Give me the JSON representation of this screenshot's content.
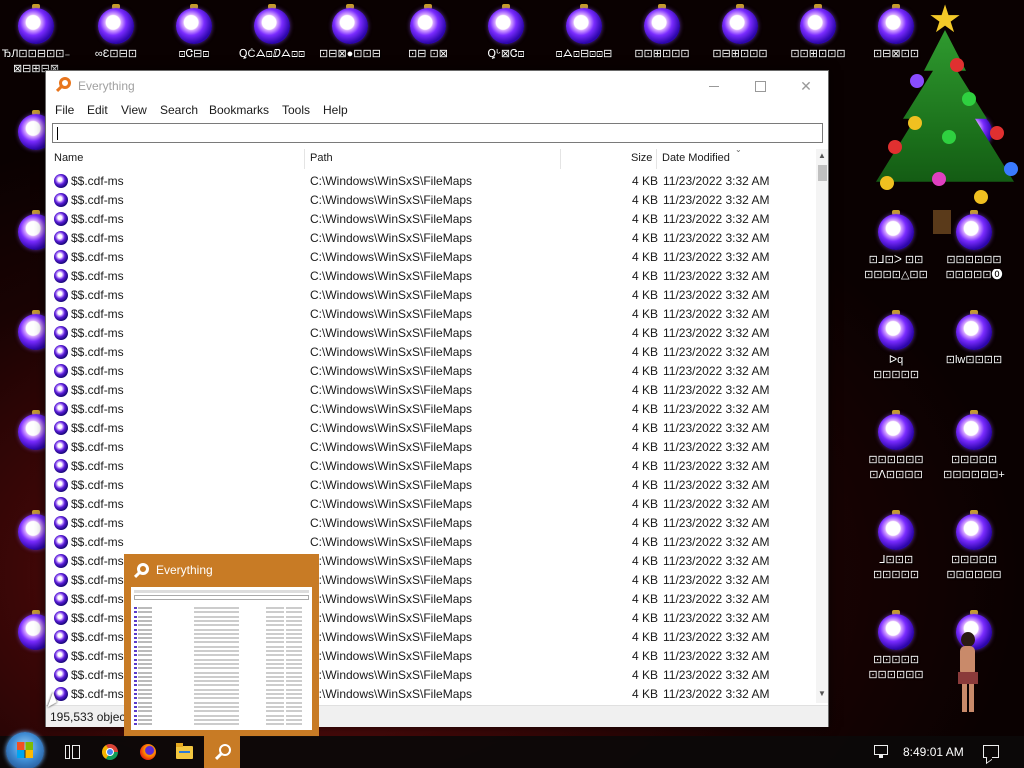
{
  "desktop": {
    "icons": [
      {
        "label": "ЂЛ⊡⊡⊟⊡⊡₋",
        "label2": "⊠⊟⊞⊟⊠"
      },
      {
        "label": "∞Ɛ⊡⊟⊡"
      },
      {
        "label": "⊡Ꮳ⊟⊡"
      },
      {
        "label": "ꝖČᗋ⊡ⅅᗋ⊡⊡"
      },
      {
        "label": "⊡⊟⊠●⊡⊡⊟"
      },
      {
        "label": "⊡⊟ ⊡⊠"
      },
      {
        "label": "Ꝗᒡ⊠Ꮳ⊡"
      },
      {
        "label": "⊡ᗋ⊡⊟⊡⊡⊟"
      },
      {
        "label": "⊡⊡⊞⊡⊡⊡"
      },
      {
        "label": "⊡⊟⊞⊡⊡⊡"
      },
      {
        "label": "⊡⊡⊞⊡⊡⊡"
      },
      {
        "label": "⊡⊟⊠⊡⊡"
      },
      {
        "label": "⊡⊡⊞⊡⊡⊡"
      }
    ],
    "right_labels": [
      {
        "a": "⊡ᐸ ⊡",
        "b": ""
      },
      {
        "a": "⊡ᒧ⊡ᐳ ⊡⊡",
        "b": "⊡⊡⊡⊡△⊡⊡"
      },
      {
        "a": "⊡⊡⊡⊡⊡⊡",
        "b": "⊡⊡⊡⊡⊡⓿"
      },
      {
        "a": "ᐅq",
        "b": "⊡⊡⊡⊡⊡"
      },
      {
        "a": "⊡lw⊡⊡⊡⊡",
        "b": ""
      },
      {
        "a": "⊡⊡⊡⊡⊡⊡",
        "b": "⊡ᐱ⊡⊡⊡⊡"
      },
      {
        "a": "⊡⊡⊡⊡⊡",
        "b": "⊡⊡⊡⊡⊡⊡+"
      },
      {
        "a": "ᒧ⊡⊡⊡",
        "b": "⊡⊡⊡⊡⊡"
      },
      {
        "a": "⊡⊡⊡⊡⊡",
        "b": "⊡⊡⊡⊡⊡⊡"
      },
      {
        "a": "⊡⊡⊡⊡⊡",
        "b": "⊡⊡⊡⊡⊡⊡"
      }
    ]
  },
  "window": {
    "title": "Everything",
    "controls": {
      "minimize": "",
      "maximize": "",
      "close": "✕"
    },
    "menu": [
      "File",
      "Edit",
      "View",
      "Search",
      "Bookmarks",
      "Tools",
      "Help"
    ],
    "search": {
      "value": "",
      "placeholder": ""
    },
    "columns": {
      "name": "Name",
      "path": "Path",
      "size": "Size",
      "date": "Date Modified"
    },
    "rows": [
      {
        "name": "$$.cdf-ms",
        "path": "C:\\Windows\\WinSxS\\FileMaps",
        "size": "4 KB",
        "date": "11/23/2022 3:32 AM"
      },
      {
        "name": "$$.cdf-ms",
        "path": "C:\\Windows\\WinSxS\\FileMaps",
        "size": "4 KB",
        "date": "11/23/2022 3:32 AM"
      },
      {
        "name": "$$.cdf-ms",
        "path": "C:\\Windows\\WinSxS\\FileMaps",
        "size": "4 KB",
        "date": "11/23/2022 3:32 AM"
      },
      {
        "name": "$$.cdf-ms",
        "path": "C:\\Windows\\WinSxS\\FileMaps",
        "size": "4 KB",
        "date": "11/23/2022 3:32 AM"
      },
      {
        "name": "$$.cdf-ms",
        "path": "C:\\Windows\\WinSxS\\FileMaps",
        "size": "4 KB",
        "date": "11/23/2022 3:32 AM"
      },
      {
        "name": "$$.cdf-ms",
        "path": "C:\\Windows\\WinSxS\\FileMaps",
        "size": "4 KB",
        "date": "11/23/2022 3:32 AM"
      },
      {
        "name": "$$.cdf-ms",
        "path": "C:\\Windows\\WinSxS\\FileMaps",
        "size": "4 KB",
        "date": "11/23/2022 3:32 AM"
      },
      {
        "name": "$$.cdf-ms",
        "path": "C:\\Windows\\WinSxS\\FileMaps",
        "size": "4 KB",
        "date": "11/23/2022 3:32 AM"
      },
      {
        "name": "$$.cdf-ms",
        "path": "C:\\Windows\\WinSxS\\FileMaps",
        "size": "4 KB",
        "date": "11/23/2022 3:32 AM"
      },
      {
        "name": "$$.cdf-ms",
        "path": "C:\\Windows\\WinSxS\\FileMaps",
        "size": "4 KB",
        "date": "11/23/2022 3:32 AM"
      },
      {
        "name": "$$.cdf-ms",
        "path": "C:\\Windows\\WinSxS\\FileMaps",
        "size": "4 KB",
        "date": "11/23/2022 3:32 AM"
      },
      {
        "name": "$$.cdf-ms",
        "path": "C:\\Windows\\WinSxS\\FileMaps",
        "size": "4 KB",
        "date": "11/23/2022 3:32 AM"
      },
      {
        "name": "$$.cdf-ms",
        "path": "C:\\Windows\\WinSxS\\FileMaps",
        "size": "4 KB",
        "date": "11/23/2022 3:32 AM"
      },
      {
        "name": "$$.cdf-ms",
        "path": "C:\\Windows\\WinSxS\\FileMaps",
        "size": "4 KB",
        "date": "11/23/2022 3:32 AM"
      },
      {
        "name": "$$.cdf-ms",
        "path": "C:\\Windows\\WinSxS\\FileMaps",
        "size": "4 KB",
        "date": "11/23/2022 3:32 AM"
      },
      {
        "name": "$$.cdf-ms",
        "path": "C:\\Windows\\WinSxS\\FileMaps",
        "size": "4 KB",
        "date": "11/23/2022 3:32 AM"
      },
      {
        "name": "$$.cdf-ms",
        "path": "C:\\Windows\\WinSxS\\FileMaps",
        "size": "4 KB",
        "date": "11/23/2022 3:32 AM"
      },
      {
        "name": "$$.cdf-ms",
        "path": "C:\\Windows\\WinSxS\\FileMaps",
        "size": "4 KB",
        "date": "11/23/2022 3:32 AM"
      },
      {
        "name": "$$.cdf-ms",
        "path": "C:\\Windows\\WinSxS\\FileMaps",
        "size": "4 KB",
        "date": "11/23/2022 3:32 AM"
      },
      {
        "name": "$$.cdf-ms",
        "path": "C:\\Windows\\WinSxS\\FileMaps",
        "size": "4 KB",
        "date": "11/23/2022 3:32 AM"
      },
      {
        "name": "$$.cdf-ms",
        "path": "C:\\Windows\\WinSxS\\FileMaps",
        "size": "4 KB",
        "date": "11/23/2022 3:32 AM"
      },
      {
        "name": "$$.cdf-ms",
        "path": "C:\\Windows\\WinSxS\\FileMaps",
        "size": "4 KB",
        "date": "11/23/2022 3:32 AM"
      },
      {
        "name": "$$.cdf-ms",
        "path": "C:\\Windows\\WinSxS\\FileMaps",
        "size": "4 KB",
        "date": "11/23/2022 3:32 AM"
      },
      {
        "name": "$$.cdf-ms",
        "path": "C:\\Windows\\WinSxS\\FileMaps",
        "size": "4 KB",
        "date": "11/23/2022 3:32 AM"
      },
      {
        "name": "$$.cdf-ms",
        "path": "C:\\Windows\\WinSxS\\FileMaps",
        "size": "4 KB",
        "date": "11/23/2022 3:32 AM"
      },
      {
        "name": "$$.cdf-ms",
        "path": "C:\\Windows\\WinSxS\\FileMaps",
        "size": "4 KB",
        "date": "11/23/2022 3:32 AM"
      },
      {
        "name": "$$.cdf-ms",
        "path": "C:\\Windows\\WinSxS\\FileMaps",
        "size": "4 KB",
        "date": "11/23/2022 3:32 AM"
      },
      {
        "name": "$$.cdf-ms",
        "path": "C:\\Windows\\WinSxS\\FileMaps",
        "size": "4 KB",
        "date": "11/23/2022 3:32 AM"
      }
    ],
    "status": "195,533 objects"
  },
  "thumbnail": {
    "title": "Everything"
  },
  "taskbar": {
    "clock": "8:49:01 AM",
    "items": [
      "start-button",
      "task-view",
      "chrome",
      "firefox",
      "file-explorer",
      "everything"
    ],
    "active_item": "everything"
  },
  "colors": {
    "accent": "#c87b25",
    "desktop_dark": "#190303",
    "desktop_red": "#7a1616",
    "ornament": "#2c05aa"
  }
}
